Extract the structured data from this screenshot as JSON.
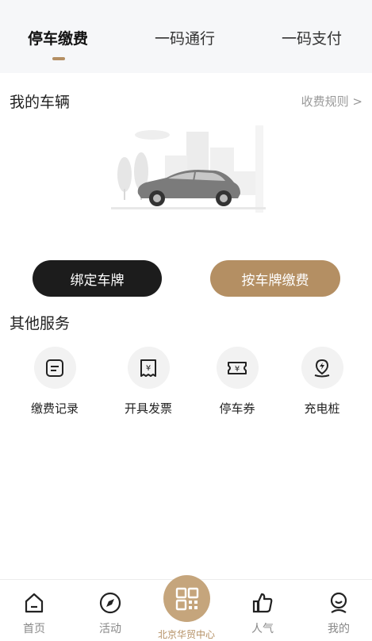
{
  "tabs": [
    {
      "label": "停车缴费",
      "active": true
    },
    {
      "label": "一码通行",
      "active": false
    },
    {
      "label": "一码支付",
      "active": false
    }
  ],
  "vehicle": {
    "title": "我的车辆",
    "rules_link": "收费规则 >"
  },
  "actions": {
    "bind_label": "绑定车牌",
    "pay_label": "按车牌缴费"
  },
  "services": {
    "title": "其他服务",
    "items": [
      {
        "label": "缴费记录",
        "icon": "receipt-list-icon"
      },
      {
        "label": "开具发票",
        "icon": "invoice-icon"
      },
      {
        "label": "停车券",
        "icon": "coupon-icon"
      },
      {
        "label": "充电桩",
        "icon": "charging-location-icon"
      }
    ]
  },
  "bottom_nav": {
    "items": [
      {
        "label": "首页",
        "icon": "home-icon"
      },
      {
        "label": "活动",
        "icon": "compass-icon"
      },
      {
        "label": "人气",
        "icon": "thumbs-up-icon"
      },
      {
        "label": "我的",
        "icon": "profile-icon"
      }
    ],
    "center_label": "北京华贸中心",
    "center_icon": "qr-code-icon"
  },
  "colors": {
    "accent": "#b48f63",
    "dark_button": "#1c1c1c",
    "tab_bg": "#f6f7f9"
  }
}
